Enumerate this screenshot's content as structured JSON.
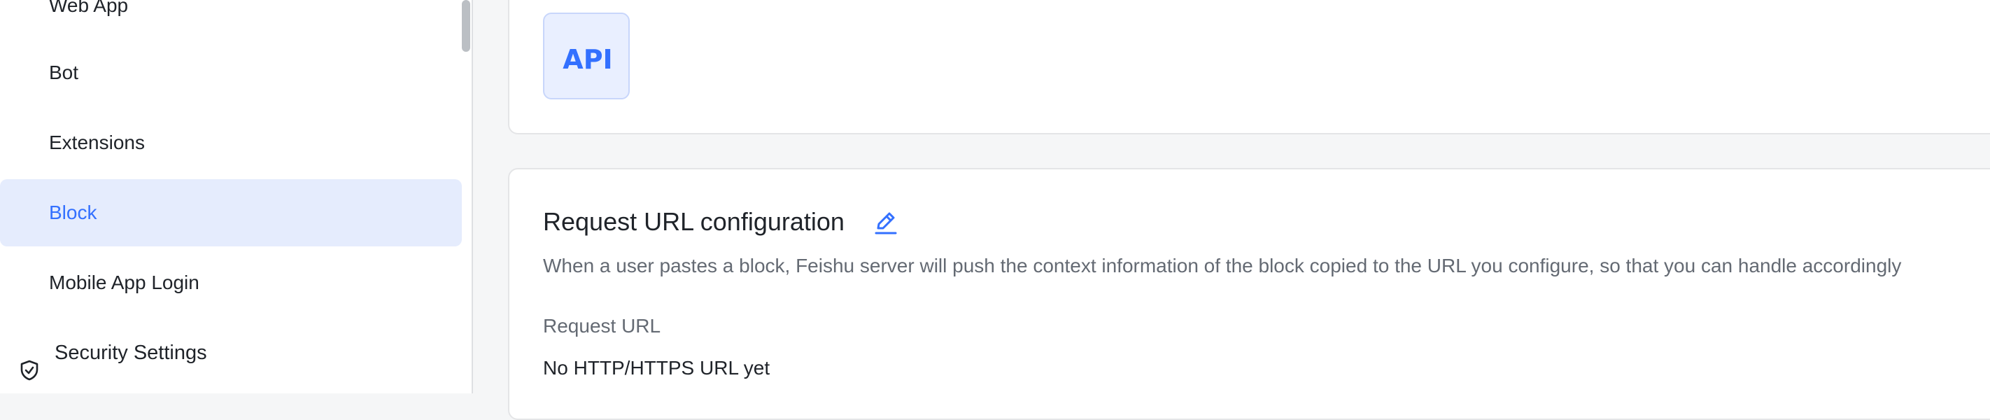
{
  "sidebar": {
    "items": [
      {
        "label": "Web App"
      },
      {
        "label": "Bot"
      },
      {
        "label": "Extensions"
      },
      {
        "label": "Block"
      },
      {
        "label": "Mobile App Login"
      }
    ],
    "section": {
      "label": "Security Settings",
      "icon": "shield-check-icon"
    }
  },
  "main": {
    "logo_text": "API",
    "request_url": {
      "title": "Request URL configuration",
      "edit_icon": "pencil-icon",
      "description": "When a user pastes a block, Feishu server will push the context information of the block copied to the URL you configure, so that you can handle accordingly",
      "field_label": "Request URL",
      "field_value": "No HTTP/HTTPS URL yet"
    }
  },
  "colors": {
    "accent": "#3370ff",
    "active_bg": "#e5ecfd",
    "text_secondary": "#646a73"
  }
}
